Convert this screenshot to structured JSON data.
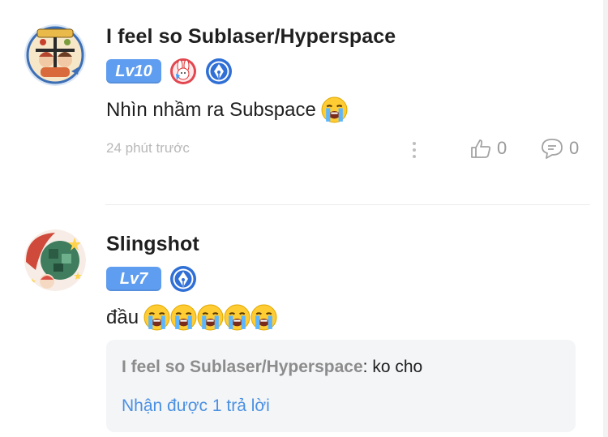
{
  "comments": [
    {
      "username": "I feel so Sublaser/Hyperspace",
      "level": "Lv10",
      "badges": [
        "rabbit-badge-icon",
        "pen-nib-badge-icon"
      ],
      "text": "Nhìn nhầm ra Subspace",
      "emoji_count": 1,
      "time": "24 phút trước",
      "likes": "0",
      "replies": "0"
    },
    {
      "username": "Slingshot",
      "level": "Lv7",
      "badges": [
        "pen-nib-badge-icon"
      ],
      "text": "đầu",
      "emoji_count": 5,
      "quote": {
        "author": "I feel so Sublaser/Hyperspace",
        "separator": ":",
        "text": "ko cho"
      },
      "reply_link": "Nhận được 1 trả lời"
    }
  ],
  "colors": {
    "level_badge": "#5e9df0",
    "link": "#4a90e2",
    "muted": "#b8b8b8",
    "quote_bg": "#f4f5f7"
  }
}
